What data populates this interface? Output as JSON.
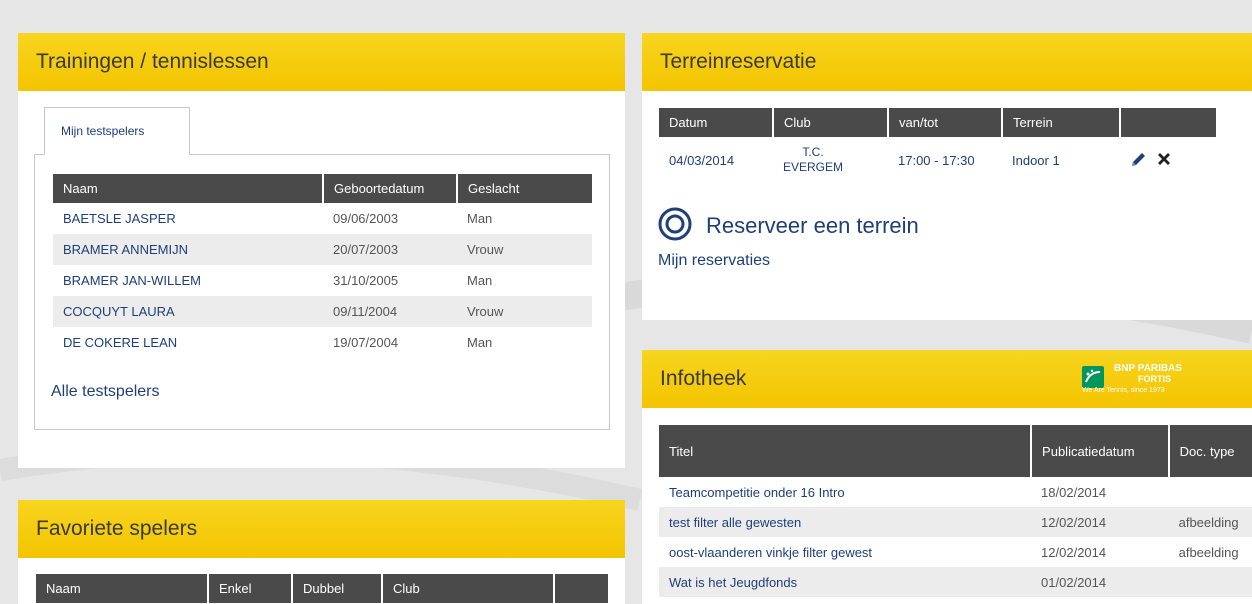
{
  "trainingen": {
    "title": "Trainingen / tennislessen",
    "tab_label": "Mijn testspelers",
    "columns": [
      "Naam",
      "Geboortedatum",
      "Geslacht"
    ],
    "rows": [
      {
        "naam": "BAETSLE JASPER",
        "geboortedatum": "09/06/2003",
        "geslacht": "Man"
      },
      {
        "naam": "BRAMER ANNEMIJN",
        "geboortedatum": "20/07/2003",
        "geslacht": "Vrouw"
      },
      {
        "naam": "BRAMER JAN-WILLEM",
        "geboortedatum": "31/10/2005",
        "geslacht": "Man"
      },
      {
        "naam": "COCQUYT LAURA",
        "geboortedatum": "09/11/2004",
        "geslacht": "Vrouw"
      },
      {
        "naam": "DE COKERE LEAN",
        "geboortedatum": "19/07/2004",
        "geslacht": "Man"
      }
    ],
    "all_link": "Alle testspelers"
  },
  "favoriete": {
    "title": "Favoriete spelers",
    "columns": [
      "Naam",
      "Enkel",
      "Dubbel",
      "Club",
      ""
    ]
  },
  "terrein": {
    "title": "Terreinreservatie",
    "columns": [
      "Datum",
      "Club",
      "van/tot",
      "Terrein",
      ""
    ],
    "rows": [
      {
        "datum": "04/03/2014",
        "club": "T.C. EVERGEM",
        "vantot": "17:00 - 17:30",
        "terrein": "Indoor 1"
      }
    ],
    "reserve_label": "Reserveer een terrein",
    "my_reservations": "Mijn reservaties",
    "icons": [
      "pencil-icon",
      "close-icon"
    ]
  },
  "infotheek": {
    "title": "Infotheek",
    "sponsor": {
      "line1": "BNP PARIBAS",
      "line2": "FORTIS",
      "tagline": "We Are Tennis, since 1973"
    },
    "columns": [
      "Titel",
      "Publicatiedatum",
      "Doc. type"
    ],
    "rows": [
      {
        "titel": "Teamcompetitie onder 16 Intro",
        "datum": "18/02/2014",
        "type": ""
      },
      {
        "titel": "test filter alle gewesten",
        "datum": "12/02/2014",
        "type": "afbeelding"
      },
      {
        "titel": "oost-vlaanderen vinkje filter gewest",
        "datum": "12/02/2014",
        "type": "afbeelding"
      },
      {
        "titel": "Wat is het Jeugdfonds",
        "datum": "01/02/2014",
        "type": ""
      }
    ]
  },
  "colors": {
    "accent": "#f3c400",
    "header": "#4a4a4a",
    "link": "#1e3f7a",
    "sponsor_green": "#00965e"
  }
}
